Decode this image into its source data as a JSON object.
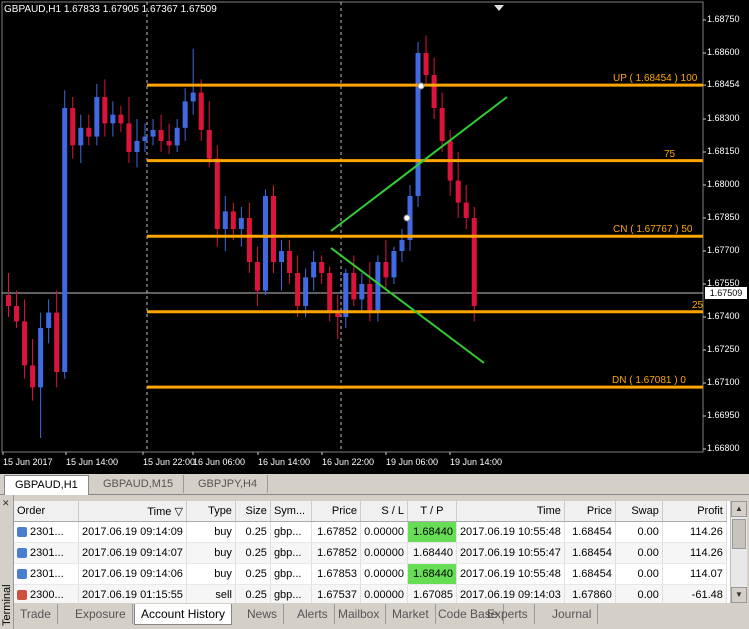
{
  "chart": {
    "symbol_header": "GBPAUD,H1  1.67833 1.67905 1.67367 1.67509",
    "current_price": "1.67509",
    "price_ticks": [
      "1.68750",
      "1.68600",
      "1.68454",
      "1.68300",
      "1.68150",
      "1.68000",
      "1.67850",
      "1.67700",
      "1.67550",
      "1.67400",
      "1.67250",
      "1.67100",
      "1.66950",
      "1.66800"
    ],
    "time_ticks": [
      "15 Jun 2017",
      "15 Jun 14:00",
      "15 Jun 22:00",
      "16 Jun 06:00",
      "16 Jun 14:00",
      "16 Jun 22:00",
      "19 Jun 06:00",
      "19 Jun 14:00"
    ],
    "fib_levels": [
      {
        "label": "UP  ( 1.68454 )  100",
        "price": 1.68454
      },
      {
        "label": "75",
        "price": 1.68111
      },
      {
        "label": "CN  ( 1.67767 )  50",
        "price": 1.67767
      },
      {
        "label": "25",
        "price": 1.67424
      },
      {
        "label": "DN  ( 1.67081 )   0",
        "price": 1.67081
      }
    ],
    "colors": {
      "bull": "#4169e1",
      "bear": "#dc143c",
      "fib": "#ffa500",
      "trend": "#32cd32",
      "grid": "#c0c0c0"
    },
    "candles": [
      [
        1.675,
        1.676,
        1.674,
        1.6745
      ],
      [
        1.6745,
        1.6752,
        1.6735,
        1.6738
      ],
      [
        1.6738,
        1.6748,
        1.6712,
        1.6718
      ],
      [
        1.6718,
        1.673,
        1.6702,
        1.6708
      ],
      [
        1.6708,
        1.6742,
        1.6685,
        1.6735
      ],
      [
        1.6735,
        1.6748,
        1.6728,
        1.6742
      ],
      [
        1.6742,
        1.6752,
        1.6708,
        1.6715
      ],
      [
        1.6715,
        1.6843,
        1.6712,
        1.6835
      ],
      [
        1.6835,
        1.684,
        1.6812,
        1.6818
      ],
      [
        1.6818,
        1.6832,
        1.681,
        1.6826
      ],
      [
        1.6826,
        1.6832,
        1.6818,
        1.6822
      ],
      [
        1.6822,
        1.6846,
        1.6818,
        1.684
      ],
      [
        1.684,
        1.6848,
        1.6822,
        1.6828
      ],
      [
        1.6828,
        1.6838,
        1.6822,
        1.6832
      ],
      [
        1.6832,
        1.6836,
        1.6824,
        1.6828
      ],
      [
        1.6828,
        1.684,
        1.681,
        1.6815
      ],
      [
        1.6815,
        1.683,
        1.6808,
        1.682
      ],
      [
        1.682,
        1.6828,
        1.6815,
        1.6822
      ],
      [
        1.6822,
        1.683,
        1.6818,
        1.6825
      ],
      [
        1.6825,
        1.6832,
        1.6815,
        1.682
      ],
      [
        1.682,
        1.6828,
        1.6814,
        1.6818
      ],
      [
        1.6818,
        1.683,
        1.6815,
        1.6826
      ],
      [
        1.6826,
        1.6844,
        1.682,
        1.6838
      ],
      [
        1.6838,
        1.6862,
        1.6832,
        1.6842
      ],
      [
        1.6842,
        1.6848,
        1.682,
        1.6825
      ],
      [
        1.6825,
        1.6838,
        1.6808,
        1.6812
      ],
      [
        1.6812,
        1.6818,
        1.6772,
        1.678
      ],
      [
        1.678,
        1.6795,
        1.677,
        1.6788
      ],
      [
        1.6788,
        1.6792,
        1.6775,
        1.678
      ],
      [
        1.678,
        1.679,
        1.6772,
        1.6785
      ],
      [
        1.6785,
        1.6792,
        1.676,
        1.6765
      ],
      [
        1.6765,
        1.6772,
        1.6745,
        1.6752
      ],
      [
        1.6752,
        1.6798,
        1.675,
        1.6795
      ],
      [
        1.6795,
        1.68,
        1.676,
        1.6765
      ],
      [
        1.6765,
        1.6775,
        1.6752,
        1.677
      ],
      [
        1.677,
        1.6775,
        1.6755,
        1.676
      ],
      [
        1.676,
        1.6768,
        1.674,
        1.6745
      ],
      [
        1.6745,
        1.6762,
        1.674,
        1.6758
      ],
      [
        1.6758,
        1.677,
        1.6752,
        1.6765
      ],
      [
        1.6765,
        1.6768,
        1.6755,
        1.676
      ],
      [
        1.676,
        1.6763,
        1.6738,
        1.6742
      ],
      [
        1.6742,
        1.675,
        1.673,
        1.674
      ],
      [
        1.674,
        1.6762,
        1.6735,
        1.676
      ],
      [
        1.676,
        1.6768,
        1.6745,
        1.6748
      ],
      [
        1.6748,
        1.676,
        1.6742,
        1.6755
      ],
      [
        1.6755,
        1.6765,
        1.6738,
        1.6742
      ],
      [
        1.6742,
        1.6768,
        1.6738,
        1.6765
      ],
      [
        1.6765,
        1.6775,
        1.6752,
        1.6758
      ],
      [
        1.6758,
        1.6772,
        1.6755,
        1.677
      ],
      [
        1.677,
        1.678,
        1.6765,
        1.6775
      ],
      [
        1.6775,
        1.68,
        1.677,
        1.6795
      ],
      [
        1.6795,
        1.6865,
        1.679,
        1.686
      ],
      [
        1.686,
        1.6868,
        1.6845,
        1.685
      ],
      [
        1.685,
        1.6858,
        1.683,
        1.6835
      ],
      [
        1.6835,
        1.6842,
        1.6815,
        1.682
      ],
      [
        1.682,
        1.6825,
        1.6795,
        1.6802
      ],
      [
        1.6802,
        1.6815,
        1.6785,
        1.6792
      ],
      [
        1.6792,
        1.68,
        1.678,
        1.6785
      ],
      [
        1.6785,
        1.679,
        1.6738,
        1.6745
      ]
    ]
  },
  "chart_tabs": [
    "GBPAUD,H1",
    "GBPAUD,M15",
    "GBPJPY,H4"
  ],
  "terminal": {
    "side_label": "Terminal",
    "columns": [
      "Order",
      "Time",
      "Type",
      "Size",
      "Sym...",
      "Price",
      "S / L",
      "T / P",
      "Time",
      "Price",
      "Swap",
      "Profit"
    ],
    "rows": [
      {
        "order": "2301...",
        "time": "2017.06.19 09:14:09",
        "type": "buy",
        "size": "0.25",
        "symbol": "gbp...",
        "price": "1.67852",
        "sl": "0.00000",
        "tp": "1.68440",
        "close_time": "2017.06.19 10:55:48",
        "close_price": "1.68454",
        "swap": "0.00",
        "profit": "114.26"
      },
      {
        "order": "2301...",
        "time": "2017.06.19 09:14:07",
        "type": "buy",
        "size": "0.25",
        "symbol": "gbp...",
        "price": "1.67852",
        "sl": "0.00000",
        "tp": "1.68440",
        "close_time": "2017.06.19 10:55:47",
        "close_price": "1.68454",
        "swap": "0.00",
        "profit": "114.26"
      },
      {
        "order": "2301...",
        "time": "2017.06.19 09:14:06",
        "type": "buy",
        "size": "0.25",
        "symbol": "gbp...",
        "price": "1.67853",
        "sl": "0.00000",
        "tp": "1.68440",
        "close_time": "2017.06.19 10:55:48",
        "close_price": "1.68454",
        "swap": "0.00",
        "profit": "114.07"
      },
      {
        "order": "2300...",
        "time": "2017.06.19 01:15:55",
        "type": "sell",
        "size": "0.25",
        "symbol": "gbp...",
        "price": "1.67537",
        "sl": "0.00000",
        "tp": "1.67085",
        "close_time": "2017.06.19 09:14:03",
        "close_price": "1.67860",
        "swap": "0.00",
        "profit": "-61.48"
      }
    ],
    "tabs": [
      "Trade",
      "Exposure",
      "Account History",
      "News",
      "Alerts",
      "Mailbox",
      "Market",
      "Code Base",
      "Experts",
      "Journal"
    ],
    "active_tab": "Account History"
  }
}
